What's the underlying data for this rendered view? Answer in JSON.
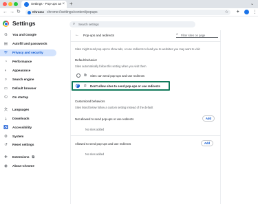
{
  "browser": {
    "tab_title": "Settings - Pop-ups and redir...",
    "tab_close": "×",
    "new_tab": "+",
    "tabs_menu": "⌄",
    "address_chip": "Chrome",
    "url": "chrome://settings/content/popups",
    "back": "←",
    "forward": "→",
    "reload": "↻",
    "star": "☆",
    "ext": "✦",
    "menu": "⋮"
  },
  "header": {
    "title": "Settings",
    "search_placeholder": "Search settings"
  },
  "sidebar": {
    "items": [
      {
        "label": "You and Google",
        "icon": "G",
        "icon_name": "google-icon"
      },
      {
        "label": "Autofill and passwords",
        "icon": "▤",
        "icon_name": "autofill-icon"
      },
      {
        "label": "Privacy and security",
        "icon": "⛨",
        "icon_name": "shield-icon",
        "active": true
      },
      {
        "label": "Performance",
        "icon": "◔",
        "icon_name": "performance-icon"
      },
      {
        "label": "Appearance",
        "icon": "◐",
        "icon_name": "palette-icon"
      },
      {
        "label": "Search engine",
        "icon": "⌕",
        "icon_name": "search-engine-icon"
      },
      {
        "label": "Default browser",
        "icon": "▭",
        "icon_name": "browser-icon"
      },
      {
        "label": "On startup",
        "icon": "⏻",
        "icon_name": "power-icon"
      },
      {
        "label": "Languages",
        "icon": "文",
        "icon_name": "language-icon"
      },
      {
        "label": "Downloads",
        "icon": "⤓",
        "icon_name": "download-icon"
      },
      {
        "label": "Accessibility",
        "icon": "♿",
        "icon_name": "accessibility-icon"
      },
      {
        "label": "System",
        "icon": "⚙",
        "icon_name": "wrench-icon"
      },
      {
        "label": "Reset settings",
        "icon": "↺",
        "icon_name": "reset-icon"
      },
      {
        "label": "Extensions",
        "icon": "✚",
        "icon_name": "puzzle-icon",
        "external": "⧉"
      },
      {
        "label": "About Chrome",
        "icon": "◉",
        "icon_name": "chrome-icon"
      }
    ]
  },
  "page": {
    "heading": "Pop-ups and redirects",
    "back": "←",
    "filter_placeholder": "Filter sites on page",
    "description": "Sites might send pop-ups to show ads, or use redirects to lead you to websites you may want to visit",
    "default_behavior": {
      "title": "Default behavior",
      "subtitle": "Sites automatically follow this setting when you visit them",
      "options": [
        {
          "label": "Sites can send pop-ups and use redirects",
          "icon": "⧉",
          "checked": false
        },
        {
          "label": "Don't allow sites to send pop-ups or use redirects",
          "icon": "⧄",
          "checked": true
        }
      ]
    },
    "customized": {
      "title": "Customized behaviors",
      "subtitle": "Sites listed below follow a custom setting instead of the default",
      "not_allowed_title": "Not allowed to send pop-ups or use redirects",
      "not_allowed_empty": "No sites added",
      "allowed_title": "Allowed to send pop-ups and use redirects",
      "allowed_empty": "No sites added",
      "add_label": "Add"
    }
  }
}
